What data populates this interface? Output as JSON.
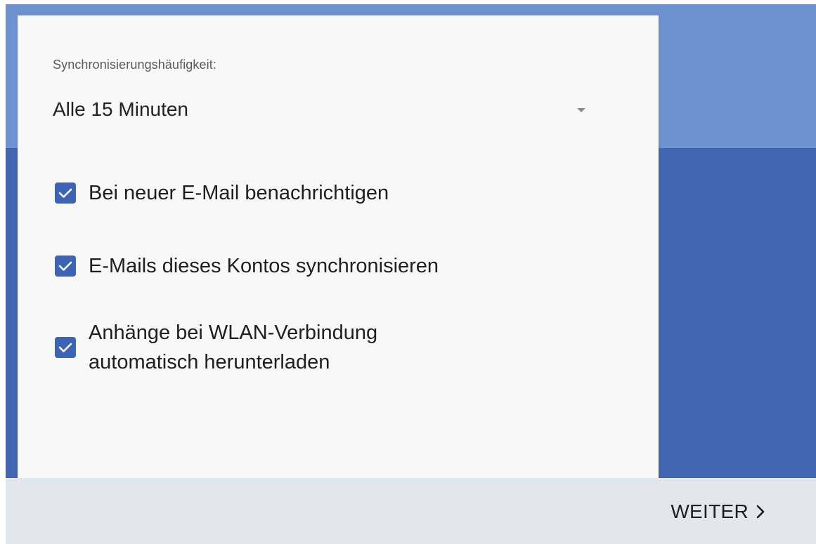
{
  "sync": {
    "frequency_label": "Synchronisierungshäufigkeit:",
    "frequency_value": "Alle 15 Minuten",
    "options": [
      {
        "label": "Bei neuer E-Mail benachrichtigen",
        "checked": true
      },
      {
        "label": "E-Mails dieses Kontos synchronisieren",
        "checked": true
      },
      {
        "label_line1": "Anhänge bei WLAN-Verbindung",
        "label_line2": "automatisch herunterladen",
        "checked": true
      }
    ]
  },
  "footer": {
    "next_label": "WEITER"
  },
  "icons": {
    "dropdown": "dropdown-arrow-icon",
    "checkbox": "checkbox-checked-icon",
    "next": "chevron-right-icon"
  },
  "colors": {
    "accent": "#3d63b4",
    "header_light": "#6e92cf",
    "header_dark": "#4266b1",
    "card": "#f8f8f8",
    "footer": "#e3e6ea"
  }
}
